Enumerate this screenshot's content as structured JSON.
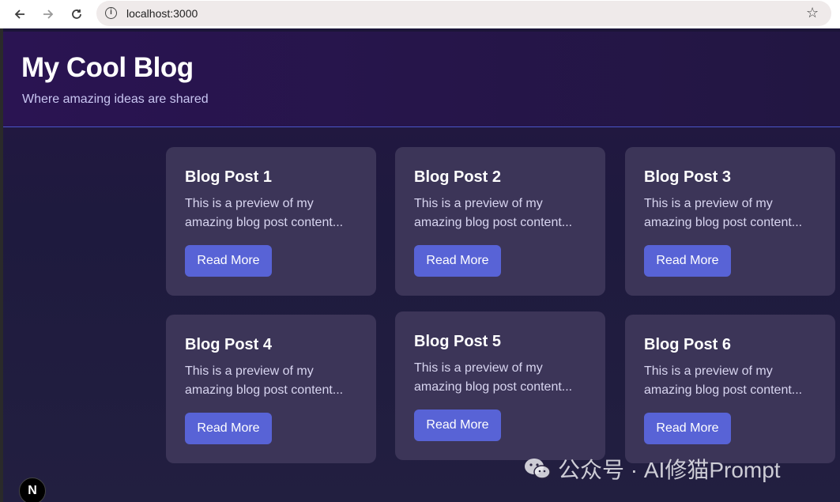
{
  "browser": {
    "url": "localhost:3000",
    "back_icon": "arrow-left-icon",
    "forward_icon": "arrow-right-icon",
    "reload_icon": "reload-icon",
    "star_icon": "star-icon"
  },
  "header": {
    "title": "My Cool Blog",
    "subtitle": "Where amazing ideas are shared"
  },
  "posts": [
    {
      "title": "Blog Post 1",
      "preview": "This is a preview of my amazing blog post content...",
      "button": "Read More"
    },
    {
      "title": "Blog Post 2",
      "preview": "This is a preview of my amazing blog post content...",
      "button": "Read More"
    },
    {
      "title": "Blog Post 3",
      "preview": "This is a preview of my amazing blog post content...",
      "button": "Read More"
    },
    {
      "title": "Blog Post 4",
      "preview": "This is a preview of my amazing blog post content...",
      "button": "Read More"
    },
    {
      "title": "Blog Post 5",
      "preview": "This is a preview of my amazing blog post content...",
      "button": "Read More"
    },
    {
      "title": "Blog Post 6",
      "preview": "This is a preview of my amazing blog post content...",
      "button": "Read More"
    }
  ],
  "next_badge": "N",
  "watermark": "公众号 · AI修猫Prompt",
  "colors": {
    "accent": "#5863d6",
    "card": "#3c3558",
    "background": "#1c1538"
  }
}
